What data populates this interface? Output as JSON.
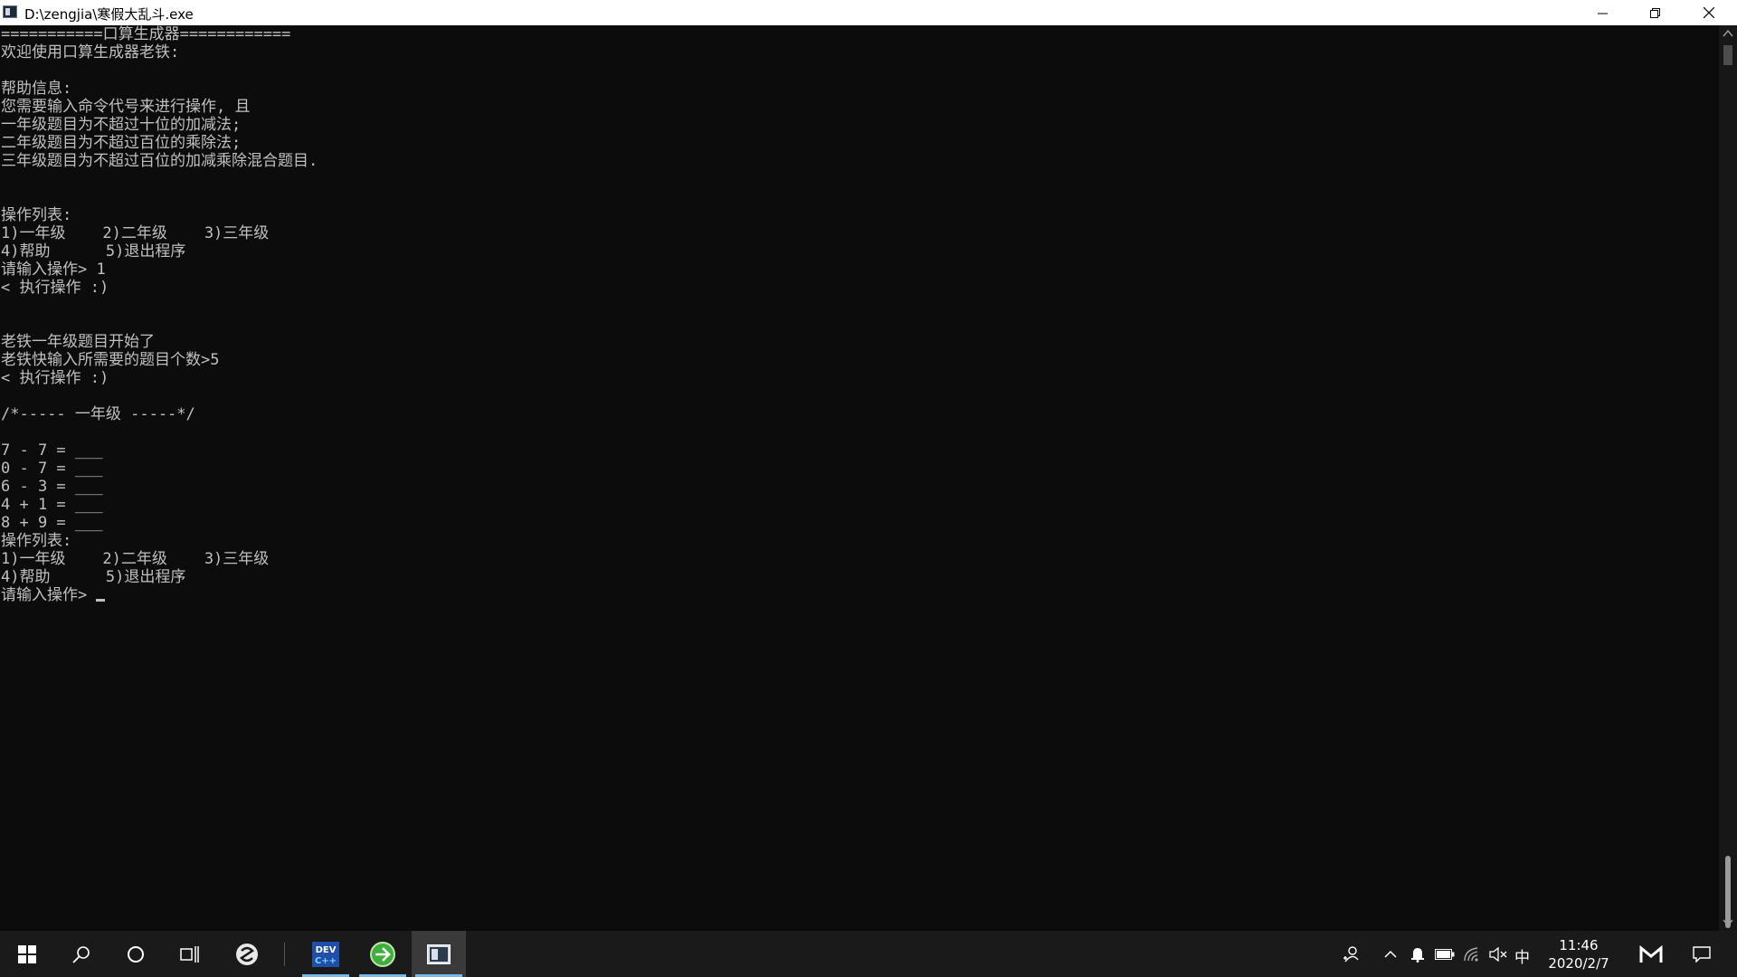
{
  "window": {
    "title": "D:\\zengjia\\寒假大乱斗.exe"
  },
  "console": {
    "lines": [
      "===========口算生成器============",
      "欢迎使用口算生成器老铁:",
      "",
      "帮助信息:",
      "您需要输入命令代号来进行操作, 且",
      "一年级题目为不超过十位的加减法;",
      "二年级题目为不超过百位的乘除法;",
      "三年级题目为不超过百位的加减乘除混合题目.",
      "",
      "",
      "操作列表:",
      "1)一年级    2)二年级    3)三年级",
      "4)帮助      5)退出程序",
      "请输入操作> 1",
      "< 执行操作 :)",
      "",
      "",
      "老铁一年级题目开始了",
      "老铁快输入所需要的题目个数>5",
      "< 执行操作 :)",
      "",
      "/*----- 一年级 -----*/",
      "",
      "7 - 7 = ___",
      "0 - 7 = ___",
      "6 - 3 = ___",
      "4 + 1 = ___",
      "8 + 9 = ___",
      "操作列表:",
      "1)一年级    2)二年级    3)三年级",
      "4)帮助      5)退出程序",
      "请输入操作> "
    ]
  },
  "taskbar": {
    "ime": "中",
    "time": "11:46",
    "date": "2020/2/7",
    "apps": [
      "start-icon",
      "search-icon",
      "cortana-icon",
      "task-view-icon",
      "sogou-icon",
      "devcpp-icon",
      "browser-icon",
      "console-icon"
    ]
  },
  "colors": {
    "console_bg": "#0c0c0c",
    "console_fg": "#c0c0c0",
    "taskbar_bg": "#1a1a1a",
    "accent": "#76b9ed"
  }
}
